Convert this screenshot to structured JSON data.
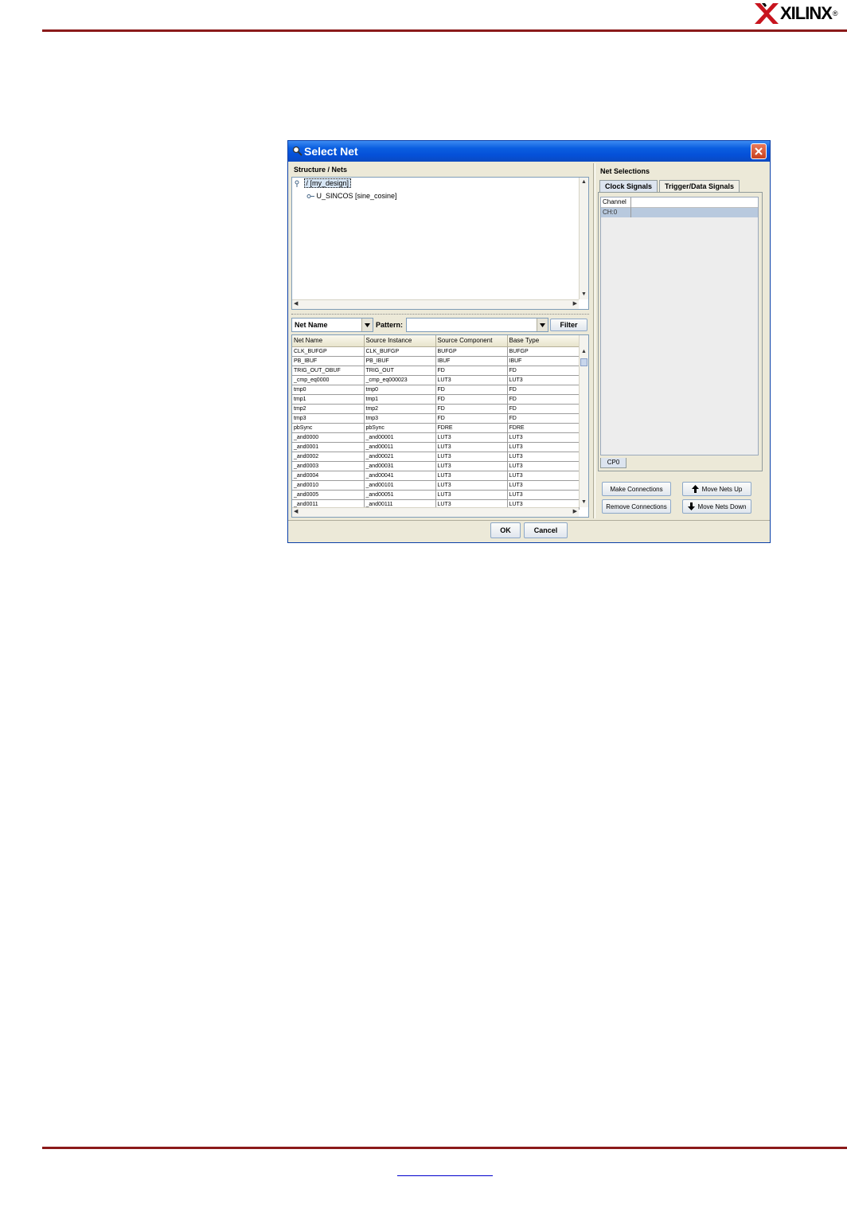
{
  "page": {
    "brand": "XILINX",
    "brand_mark": "®"
  },
  "dialog": {
    "title": "Select Net",
    "structure_label": "Structure / Nets",
    "tree": [
      {
        "label": "/ [my_design]",
        "level": 0,
        "selected": true
      },
      {
        "label": "U_SINCOS [sine_cosine]",
        "level": 1,
        "selected": false
      }
    ],
    "filter": {
      "field_value": "Net Name",
      "pattern_label": "Pattern:",
      "pattern_value": "",
      "filter_button": "Filter"
    },
    "net_table": {
      "columns": [
        "Net Name",
        "Source Instance",
        "Source Component",
        "Base Type"
      ],
      "rows": [
        [
          "CLK_BUFGP",
          "CLK_BUFGP",
          "BUFGP",
          "BUFGP"
        ],
        [
          "PB_IBUF",
          "PB_IBUF",
          "IBUF",
          "IBUF"
        ],
        [
          "TRIG_OUT_OBUF",
          "TRIG_OUT",
          "FD",
          "FD"
        ],
        [
          "_cmp_eq0000",
          "_cmp_eq000023",
          "LUT3",
          "LUT3"
        ],
        [
          "tmp0",
          "tmp0",
          "FD",
          "FD"
        ],
        [
          "tmp1",
          "tmp1",
          "FD",
          "FD"
        ],
        [
          "tmp2",
          "tmp2",
          "FD",
          "FD"
        ],
        [
          "tmp3",
          "tmp3",
          "FD",
          "FD"
        ],
        [
          "pbSync",
          "pbSync",
          "FDRE",
          "FDRE"
        ],
        [
          "_and0000",
          "_and00001",
          "LUT3",
          "LUT3"
        ],
        [
          "_and0001",
          "_and00011",
          "LUT3",
          "LUT3"
        ],
        [
          "_and0002",
          "_and00021",
          "LUT3",
          "LUT3"
        ],
        [
          "_and0003",
          "_and00031",
          "LUT3",
          "LUT3"
        ],
        [
          "_and0004",
          "_and00041",
          "LUT3",
          "LUT3"
        ],
        [
          "_and0010",
          "_and00101",
          "LUT3",
          "LUT3"
        ],
        [
          "_and0005",
          "_and00051",
          "LUT3",
          "LUT3"
        ],
        [
          "_and0011",
          "_and00111",
          "LUT3",
          "LUT3"
        ]
      ]
    },
    "net_selections": {
      "label": "Net Selections",
      "tabs": [
        {
          "label": "Clock Signals",
          "active": true
        },
        {
          "label": "Trigger/Data Signals",
          "active": false
        }
      ],
      "channel_header": "Channel",
      "channel_rows": [
        "CH:0"
      ],
      "bottom_tab": "CP0"
    },
    "buttons": {
      "make_connections": "Make Connections",
      "remove_connections": "Remove Connections",
      "move_up": "Move Nets Up",
      "move_down": "Move Nets Down",
      "ok": "OK",
      "cancel": "Cancel"
    },
    "colors": {
      "titlebar": "#0a5ee0",
      "close": "#c8401e",
      "selection": "#b8c9de",
      "page_rule": "#8b1a1a"
    }
  }
}
